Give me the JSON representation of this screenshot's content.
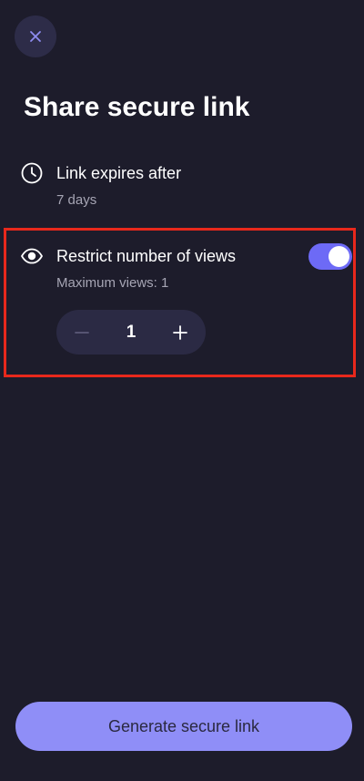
{
  "header": {
    "close_icon": "close-icon",
    "title": "Share secure link"
  },
  "expiry": {
    "icon": "clock-icon",
    "label": "Link expires after",
    "value": "7 days"
  },
  "views": {
    "icon": "eye-icon",
    "label": "Restrict number of views",
    "subtitle": "Maximum views: 1",
    "toggle_on": true,
    "stepper_value": "1",
    "decrement_icon": "minus-icon",
    "increment_icon": "plus-icon"
  },
  "footer": {
    "button_label": "Generate secure link"
  },
  "colors": {
    "background": "#1d1c2b",
    "accent": "#6d6af6",
    "primary_button": "#8f8ef7",
    "highlight": "#e8281c"
  }
}
